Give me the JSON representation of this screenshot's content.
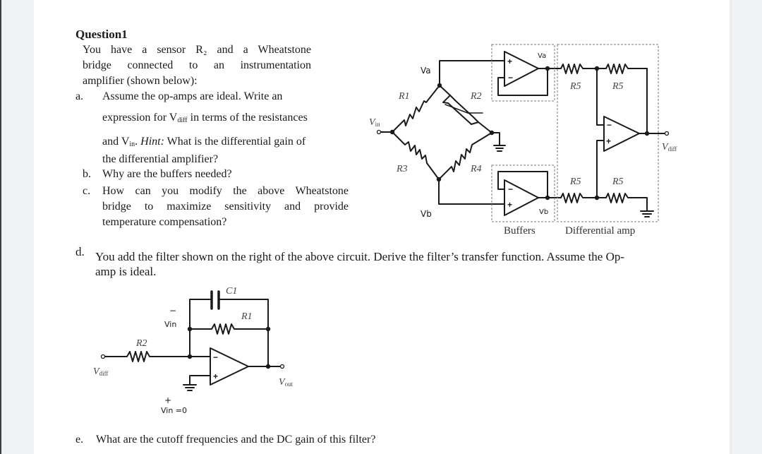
{
  "document": {
    "title": "Question1",
    "intro_lines": [
      "You have a sensor R₂ and a Wheatstone",
      "bridge connected to an instrumentation",
      "amplifier (shown below):"
    ],
    "parts": {
      "a": {
        "label": "a.",
        "line1": "Assume the op-amps are ideal. Write an",
        "line2_pre": "expression for V",
        "line2_sub": "diff",
        "line2_post": " in terms of the resistances",
        "line3_pre": "and V",
        "line3_sub": "in",
        "line3_mid": ". ",
        "line3_hint": "Hint:",
        "line3_post": " What is the differential gain of",
        "line4": "the differential amplifier?"
      },
      "b": {
        "label": "b.",
        "text": "Why are the buffers needed?"
      },
      "c": {
        "label": "c.",
        "line1": "How can you modify the above Wheatstone",
        "line2": "bridge to maximize sensitivity and provide",
        "line3": "temperature compensation?"
      },
      "d": {
        "label": "d.",
        "line1": "You add the filter shown on the right of the above circuit. Derive the filter’s transfer function. Assume the Op-",
        "line2": "amp is ideal."
      },
      "e": {
        "label": "e.",
        "text": "What are the cutoff frequencies and the DC gain of this filter?"
      }
    }
  },
  "bridge_circuit": {
    "labels": {
      "vin": "V",
      "vin_sub": "in",
      "va": "Va",
      "vb": "Vb",
      "r1": "R1",
      "r2": "R2",
      "r3": "R3",
      "r4": "R4",
      "r5": "R5",
      "vdiff": "V",
      "vdiff_sub": "diff",
      "buffers": "Buffers",
      "diff_amp": "Differential amp",
      "plus": "+",
      "minus": "−"
    }
  },
  "filter_circuit": {
    "labels": {
      "c1": "C1",
      "r1": "R1",
      "r2": "R2",
      "vdiff": "V",
      "vdiff_sub": "diff",
      "vout": "V",
      "vout_sub": "out",
      "vin_minus": "Vin",
      "vin_plus": "Vin =0",
      "plus": "+",
      "minus": "−"
    }
  }
}
